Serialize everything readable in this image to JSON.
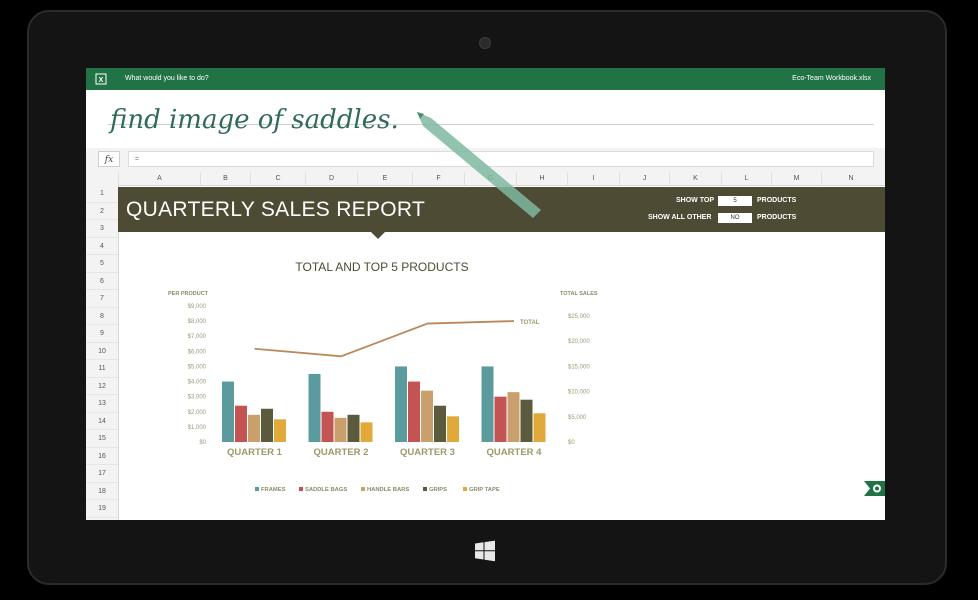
{
  "app": {
    "tell_me": "What would you like to do?",
    "workbook_name": "Eco-Team Workbook.xlsx",
    "ink_text": "find image of saddles.",
    "formula_fx": "fx",
    "formula_value": "="
  },
  "columns": [
    "A",
    "B",
    "C",
    "D",
    "E",
    "F",
    "G",
    "H",
    "I",
    "J",
    "K",
    "L",
    "M",
    "N"
  ],
  "rows": [
    "1",
    "2",
    "3",
    "4",
    "5",
    "6",
    "7",
    "8",
    "9",
    "10",
    "11",
    "12",
    "13",
    "14",
    "15",
    "16",
    "17",
    "18",
    "19"
  ],
  "banner": {
    "title": "QUARTERLY SALES REPORT",
    "show_top_label": "SHOW TOP",
    "show_top_value": "5",
    "show_top_suffix": "PRODUCTS",
    "show_other_label": "SHOW ALL OTHER",
    "show_other_value": "NO",
    "show_other_suffix": "PRODUCTS"
  },
  "colors": {
    "excel_green": "#217346",
    "banner": "#4d4b33",
    "frames": "#5b9b9e",
    "saddle_bags": "#c45353",
    "handle_bars": "#c9a06b",
    "grips": "#5c5a3c",
    "grip_tape": "#e1a93a",
    "total_line": "#b9895a"
  },
  "chart_data": {
    "type": "bar",
    "title": "TOTAL AND TOP 5 PRODUCTS",
    "ylabel": "PER PRODUCT",
    "y2label": "TOTAL SALES",
    "categories": [
      "QUARTER 1",
      "QUARTER 2",
      "QUARTER 3",
      "QUARTER 4"
    ],
    "ylim": [
      0,
      9000
    ],
    "yticks": [
      "$0",
      "$1,000",
      "$2,000",
      "$3,000",
      "$4,000",
      "$5,000",
      "$6,000",
      "$7,000",
      "$8,000",
      "$9,000"
    ],
    "y2lim": [
      0,
      25000
    ],
    "y2ticks": [
      "$0",
      "$5,000",
      "$10,000",
      "$15,000",
      "$20,000",
      "$25,000"
    ],
    "series": [
      {
        "name": "FRAMES",
        "values": [
          4000,
          4500,
          5000,
          5000
        ]
      },
      {
        "name": "SADDLE BAGS",
        "values": [
          2400,
          2000,
          4000,
          3000
        ]
      },
      {
        "name": "HANDLE BARS",
        "values": [
          1800,
          1600,
          3400,
          3300
        ]
      },
      {
        "name": "GRIPS",
        "values": [
          2200,
          1800,
          2400,
          2800
        ]
      },
      {
        "name": "GRIP TAPE",
        "values": [
          1500,
          1300,
          1700,
          1900
        ]
      }
    ],
    "line_series": {
      "name": "TOTAL",
      "values": [
        18500,
        17000,
        23500,
        24000
      ]
    },
    "legend": "bottom",
    "grid": false
  }
}
